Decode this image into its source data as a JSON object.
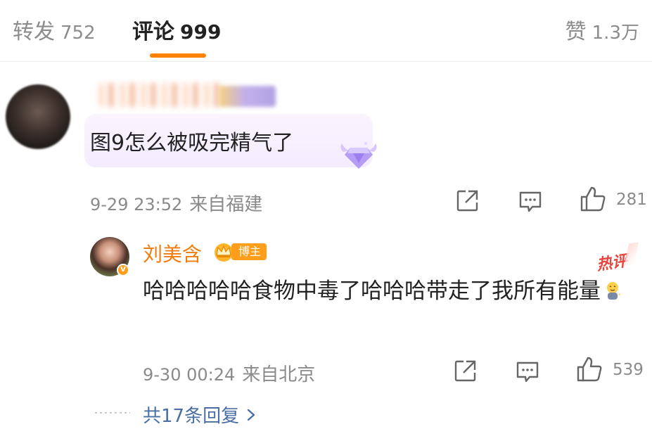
{
  "tabs": {
    "repost": {
      "label": "转发",
      "count": "752"
    },
    "comment": {
      "label": "评论",
      "count": "999"
    },
    "like": {
      "label": "赞",
      "count": "1.3万"
    }
  },
  "comment": {
    "text": "图9怎么被吸完精气了",
    "time": "9-29 23:52",
    "location": "来自福建",
    "like_count": "281"
  },
  "reply": {
    "author": "刘美含",
    "author_badge": "博主",
    "hot_badge": "热评",
    "text": "哈哈哈哈哈食物中毒了哈哈哈带走了我所有能量",
    "time": "9-30 00:24",
    "location": "来自北京",
    "like_count": "539",
    "more_replies": "共17条回复"
  },
  "colors": {
    "accent": "#ff8200",
    "reply_name": "#f07c0e",
    "link": "#4a6fa5",
    "hot": "#e8463c"
  },
  "icons": [
    "share-icon",
    "comment-icon",
    "thumbs-up-icon",
    "gem-icon",
    "crown-icon",
    "chevron-right-icon",
    "verified-icon",
    "emoji-icon"
  ]
}
